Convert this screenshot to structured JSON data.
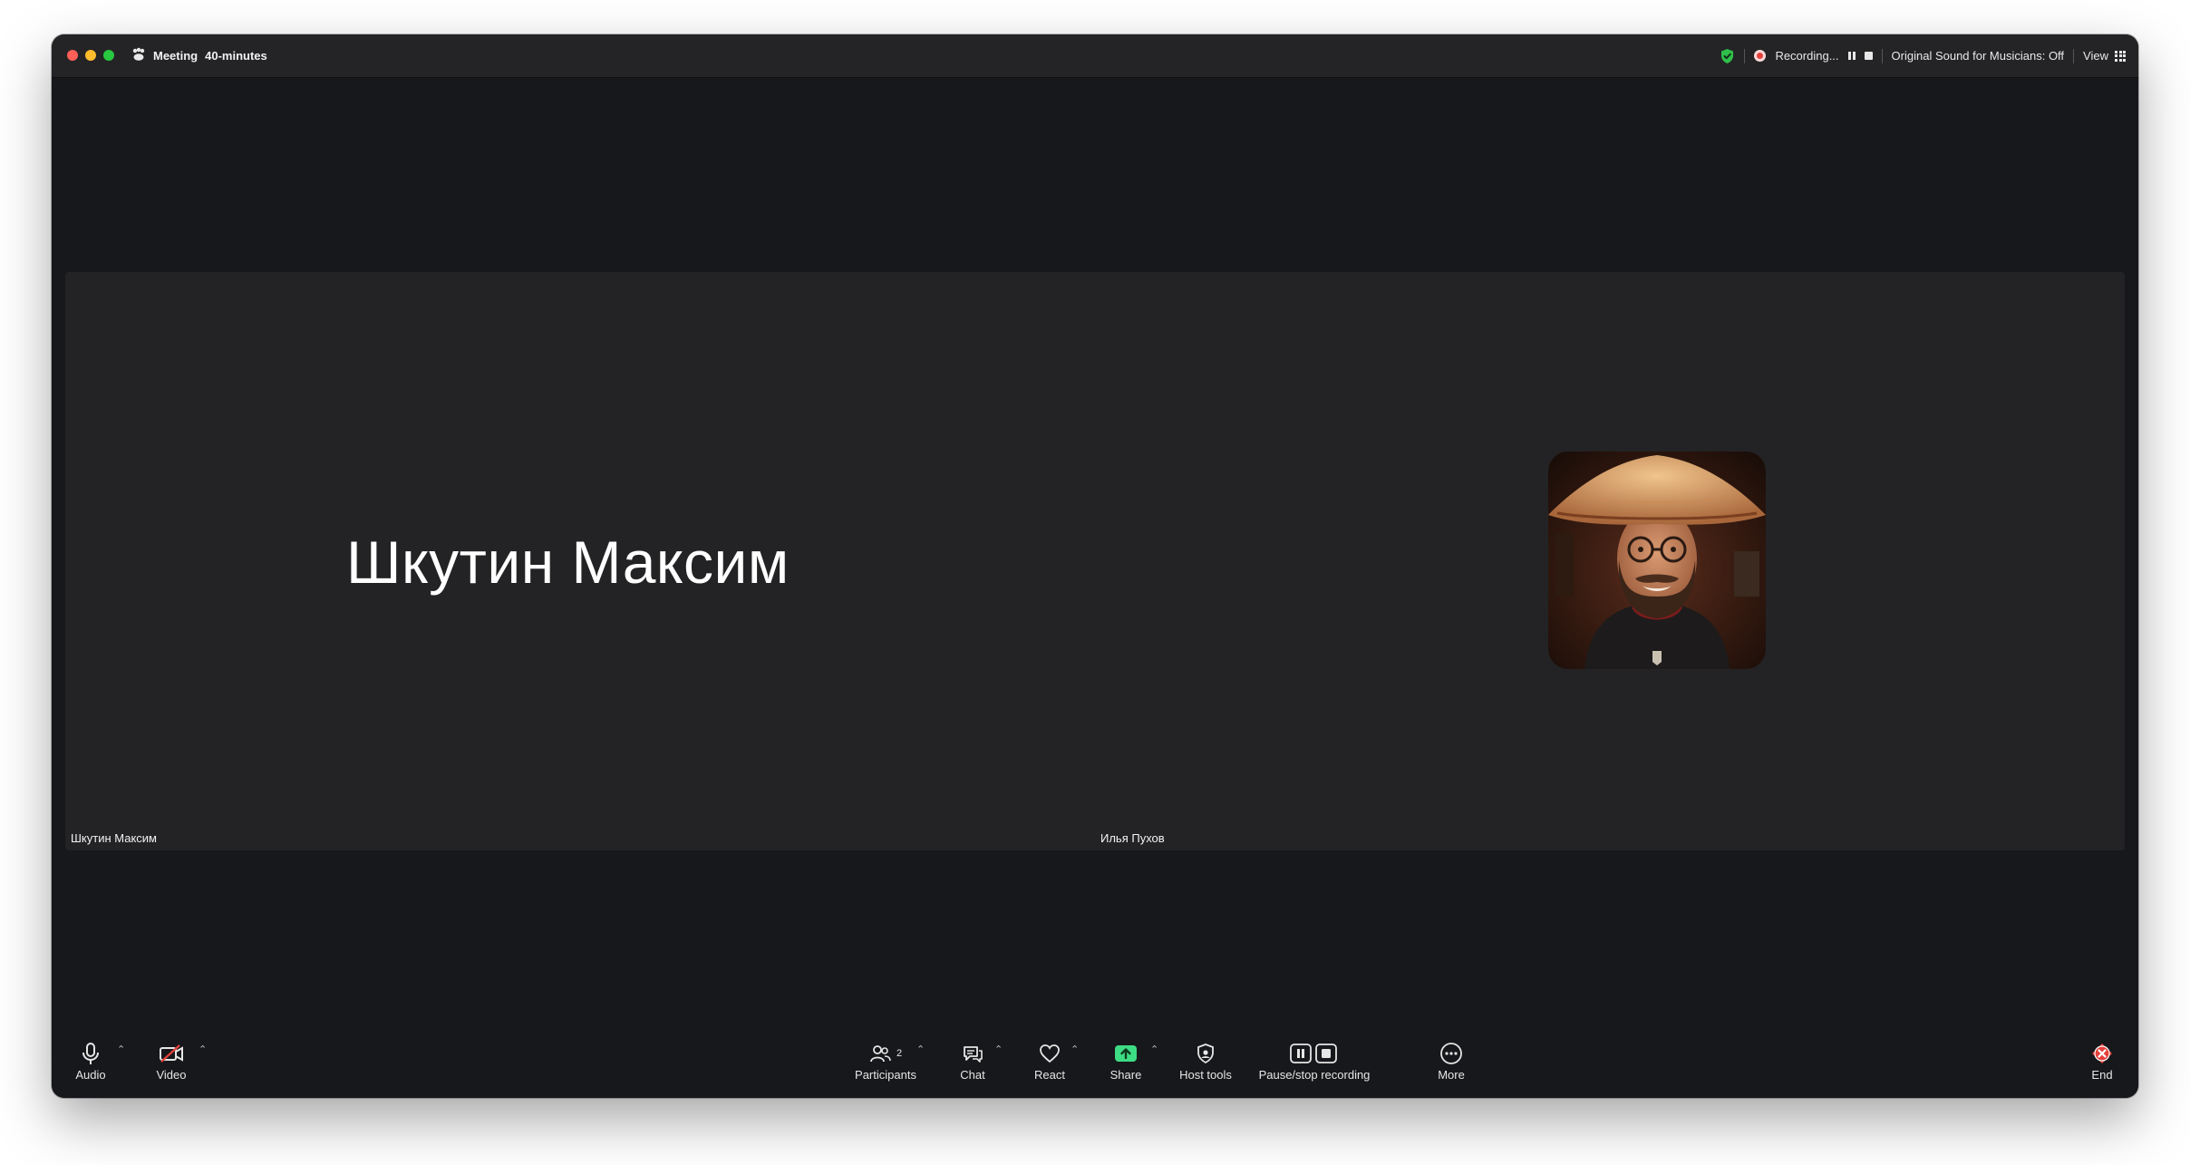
{
  "window": {
    "title": "Meeting",
    "subtitle": "40-minutes"
  },
  "topbar": {
    "recording_label": "Recording...",
    "original_sound": "Original Sound for Musicians: Off",
    "view_label": "View"
  },
  "participants": [
    {
      "name": "Шкутин Максим",
      "display_name": "Шкутин Максим",
      "video": "off"
    },
    {
      "name": "Илья Пухов",
      "video": "avatar"
    }
  ],
  "toolbar": {
    "audio_label": "Audio",
    "video_label": "Video",
    "participants_label": "Participants",
    "participants_count": "2",
    "chat_label": "Chat",
    "react_label": "React",
    "share_label": "Share",
    "host_tools_label": "Host tools",
    "pause_stop_label": "Pause/stop recording",
    "more_label": "More",
    "end_label": "End"
  },
  "colors": {
    "share_accent": "#3ddc84",
    "end_accent": "#e5413b",
    "shield": "#2fbf4a",
    "recording_dot": "#e5413b"
  },
  "icons": [
    "zoom-logo-icon",
    "shield-icon",
    "recording-dot-icon",
    "pause-icon",
    "stop-icon",
    "grid-icon",
    "microphone-icon",
    "video-off-icon",
    "participants-icon",
    "chat-icon",
    "heart-icon",
    "share-arrow-icon",
    "shield-host-icon",
    "pause-stop-icon",
    "more-dots-icon",
    "end-icon"
  ]
}
